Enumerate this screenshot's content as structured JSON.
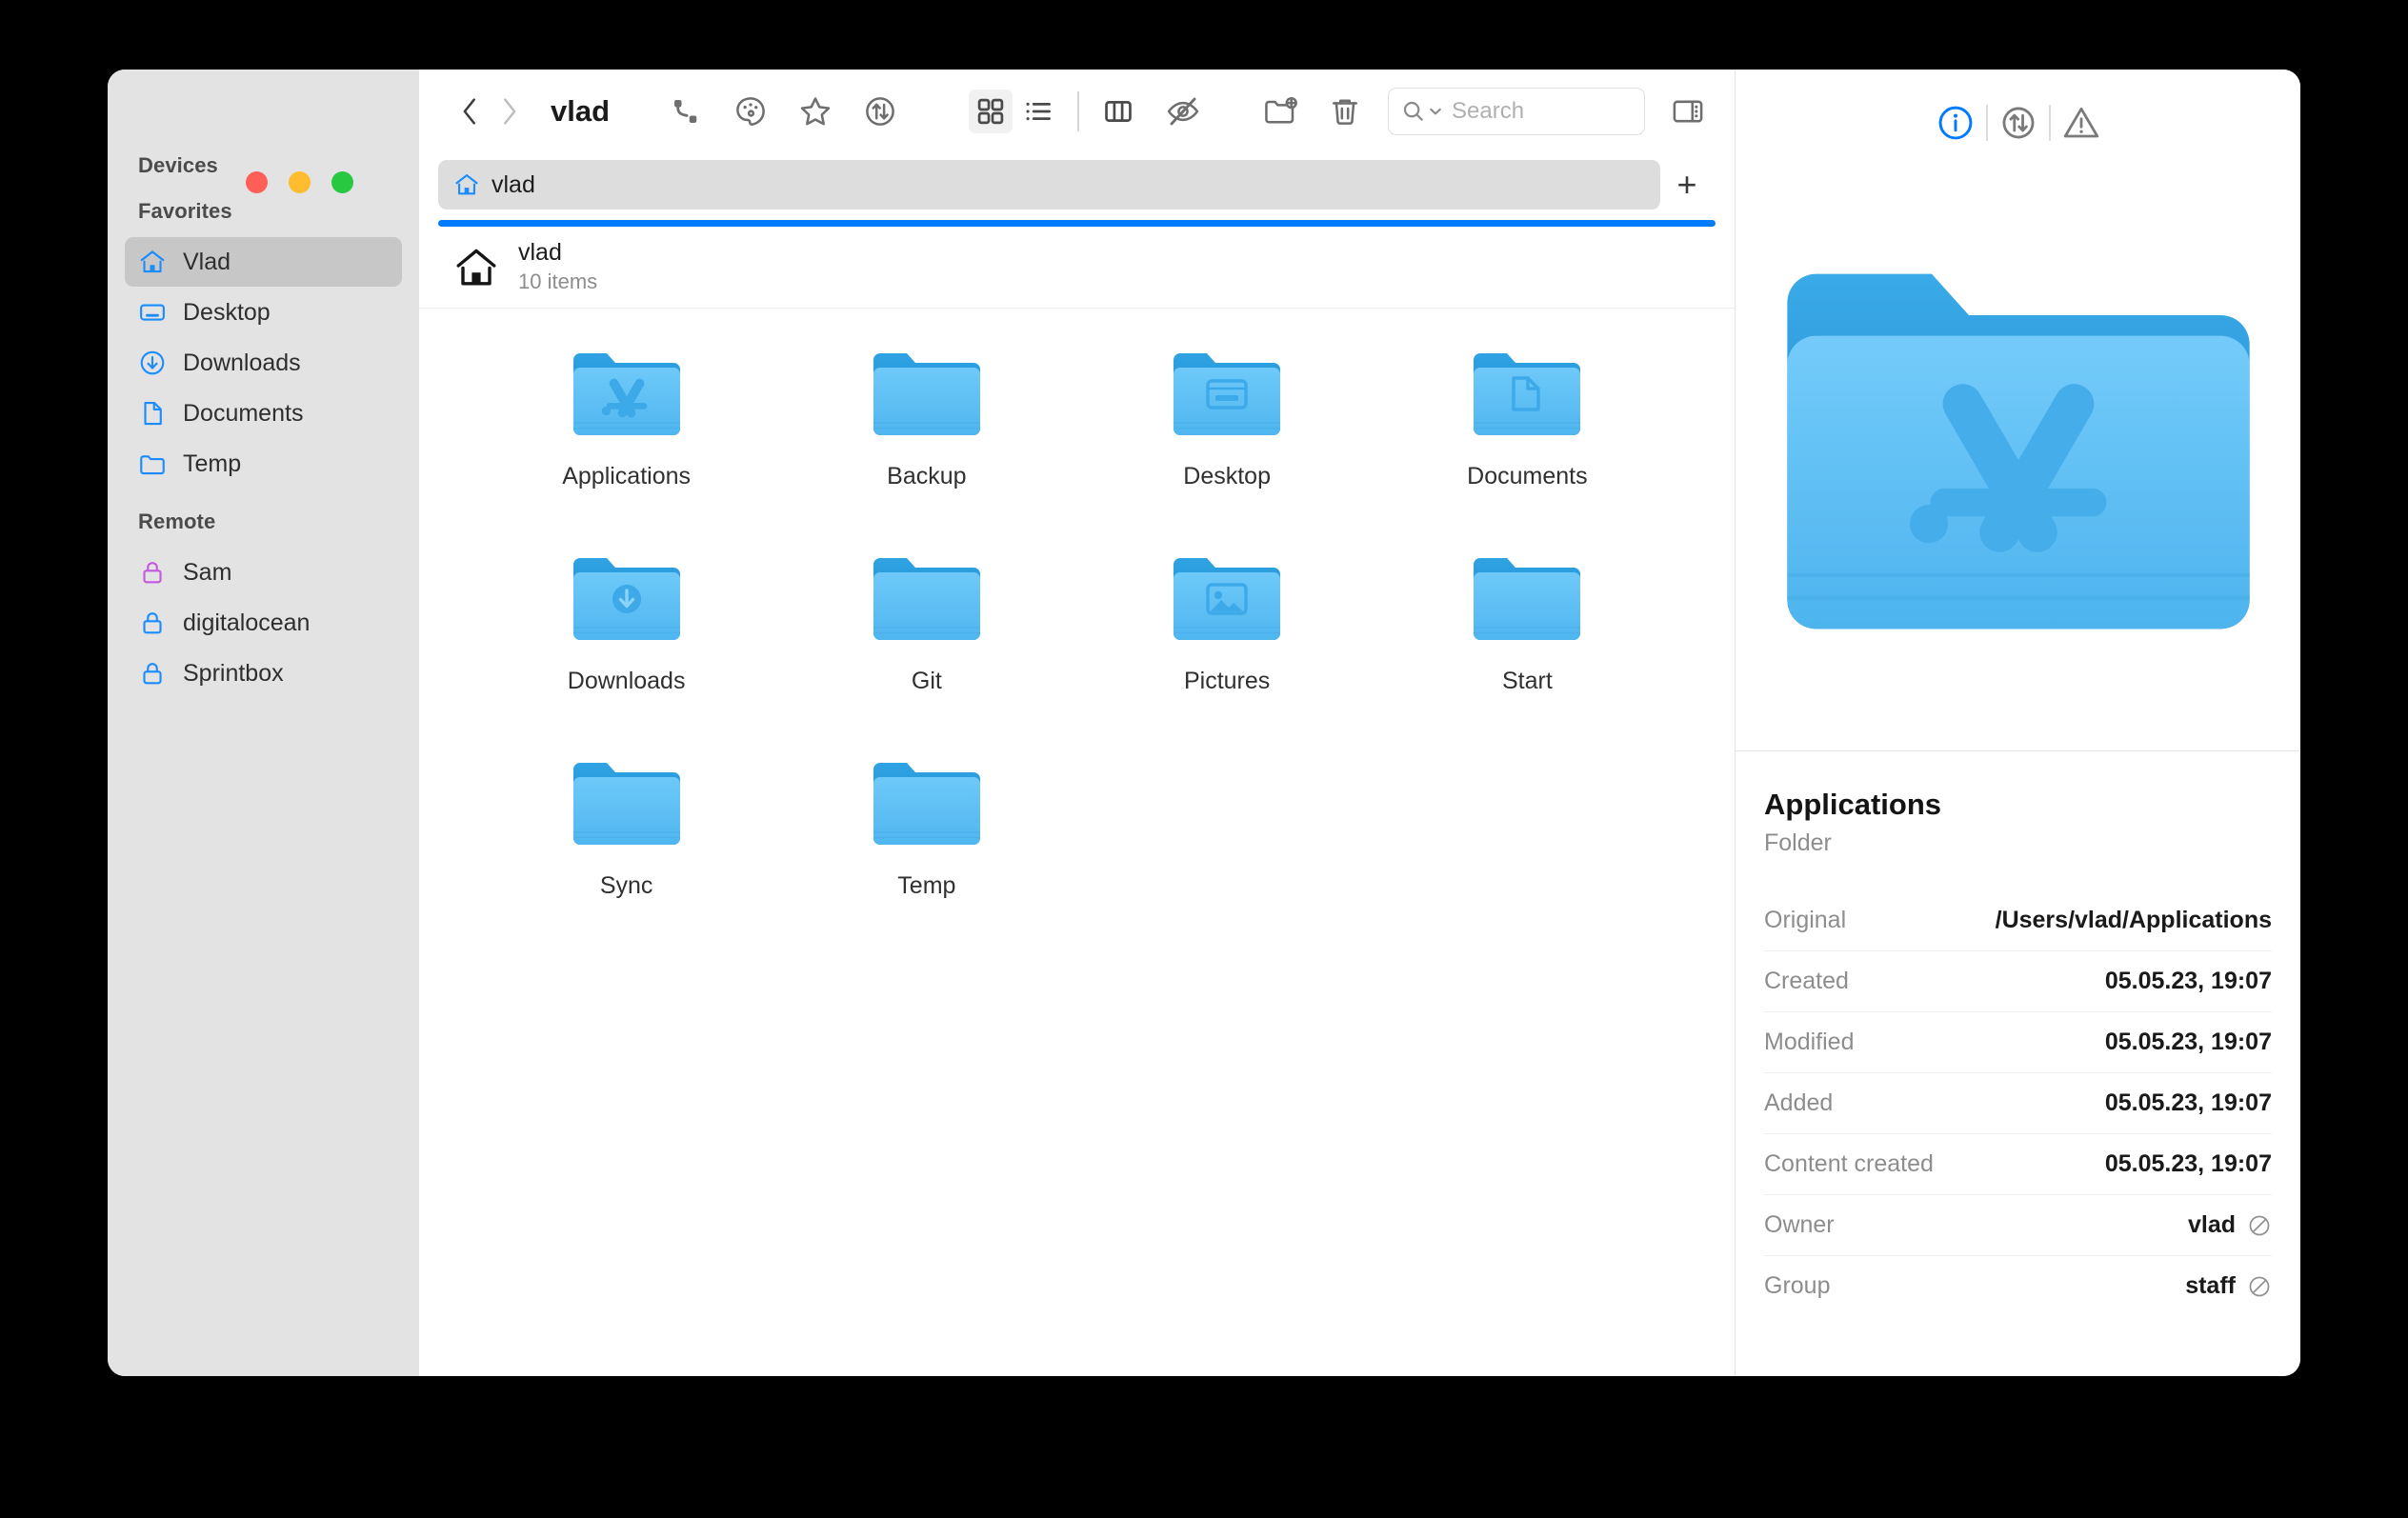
{
  "window": {
    "traffic_lights": [
      "close",
      "minimize",
      "zoom"
    ],
    "colors": {
      "accent": "#007aff",
      "sidebar_bg": "#e3e3e3",
      "selected_bg": "#c7c7c7",
      "folder_blue": "#55bcf6",
      "folder_tab_blue": "#2a9ee0"
    }
  },
  "toolbar": {
    "back_label": "‹",
    "forward_label": "›",
    "title": "vlad",
    "icons": [
      {
        "name": "path-link-icon",
        "label": "Path"
      },
      {
        "name": "palette-icon",
        "label": "Tag color"
      },
      {
        "name": "star-icon",
        "label": "Favorite"
      },
      {
        "name": "sort-arrows-icon",
        "label": "Sort"
      }
    ],
    "view_modes": [
      {
        "name": "grid-view",
        "label": "Icons",
        "active": true
      },
      {
        "name": "list-view",
        "label": "List",
        "active": false
      },
      {
        "name": "column-view",
        "label": "Columns",
        "active": false
      }
    ],
    "hidden_files_label": "Show hidden",
    "new_folder_label": "New Folder",
    "trash_label": "Move to Trash",
    "sidebar_toggle_label": "Toggle Info Panel"
  },
  "search": {
    "placeholder": "Search",
    "value": ""
  },
  "sidebar": {
    "groups": [
      {
        "title": "Devices",
        "items": []
      },
      {
        "title": "Favorites",
        "items": [
          {
            "label": "Vlad",
            "icon": "home-icon",
            "selected": true
          },
          {
            "label": "Desktop",
            "icon": "desktop-icon",
            "selected": false
          },
          {
            "label": "Downloads",
            "icon": "download-circle-icon",
            "selected": false
          },
          {
            "label": "Documents",
            "icon": "document-icon",
            "selected": false
          },
          {
            "label": "Temp",
            "icon": "folder-icon",
            "selected": false
          }
        ]
      },
      {
        "title": "Remote",
        "items": [
          {
            "label": "Sam",
            "icon": "lock-icon",
            "selected": false,
            "color": "#c35ae0"
          },
          {
            "label": "digitalocean",
            "icon": "lock-icon",
            "selected": false,
            "color": "#1a8cff"
          },
          {
            "label": "Sprintbox",
            "icon": "lock-icon",
            "selected": false,
            "color": "#1a8cff"
          }
        ]
      }
    ]
  },
  "tabs": {
    "items": [
      {
        "label": "vlad",
        "icon": "home-icon",
        "active": true
      }
    ],
    "add_label": "+"
  },
  "path_header": {
    "name": "vlad",
    "count": "10 items",
    "icon": "home-icon"
  },
  "files": [
    {
      "name": "Applications",
      "icon": "folder-appstore",
      "selected": true
    },
    {
      "name": "Backup",
      "icon": "folder-plain",
      "selected": false
    },
    {
      "name": "Desktop",
      "icon": "folder-desktop",
      "selected": false
    },
    {
      "name": "Documents",
      "icon": "folder-document",
      "selected": false
    },
    {
      "name": "Downloads",
      "icon": "folder-download",
      "selected": false
    },
    {
      "name": "Git",
      "icon": "folder-plain",
      "selected": false
    },
    {
      "name": "Pictures",
      "icon": "folder-picture",
      "selected": false
    },
    {
      "name": "Start",
      "icon": "folder-plain",
      "selected": false
    },
    {
      "name": "Sync",
      "icon": "folder-plain",
      "selected": false
    },
    {
      "name": "Temp",
      "icon": "folder-plain",
      "selected": false
    }
  ],
  "info_panel": {
    "tabs": [
      {
        "name": "info-icon",
        "label": "Info",
        "active": true
      },
      {
        "name": "transfer-icon",
        "label": "Transfers",
        "active": false
      },
      {
        "name": "warning-icon",
        "label": "Alerts",
        "active": false
      }
    ],
    "preview_icon": "folder-appstore",
    "title": "Applications",
    "kind": "Folder",
    "rows": [
      {
        "key": "Original",
        "value": "/Users/vlad/Applications",
        "editable": false
      },
      {
        "key": "Created",
        "value": "05.05.23, 19:07",
        "editable": false
      },
      {
        "key": "Modified",
        "value": "05.05.23, 19:07",
        "editable": false
      },
      {
        "key": "Added",
        "value": "05.05.23, 19:07",
        "editable": false
      },
      {
        "key": "Content created",
        "value": "05.05.23, 19:07",
        "editable": false
      },
      {
        "key": "Owner",
        "value": "vlad",
        "editable": true
      },
      {
        "key": "Group",
        "value": "staff",
        "editable": true
      }
    ]
  }
}
